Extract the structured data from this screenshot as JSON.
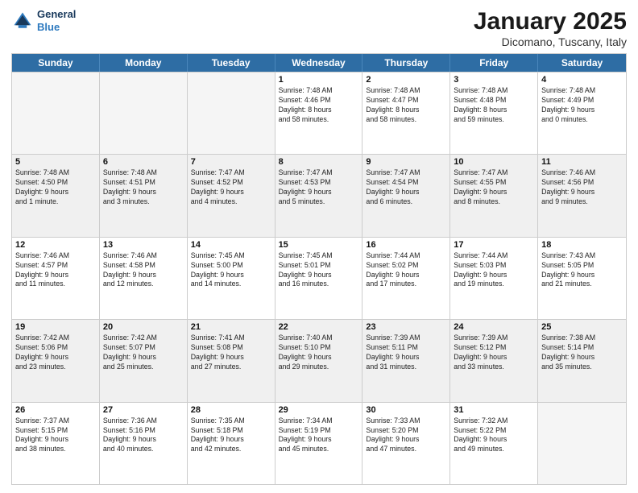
{
  "header": {
    "logo_general": "General",
    "logo_blue": "Blue",
    "month_title": "January 2025",
    "location": "Dicomano, Tuscany, Italy"
  },
  "days_of_week": [
    "Sunday",
    "Monday",
    "Tuesday",
    "Wednesday",
    "Thursday",
    "Friday",
    "Saturday"
  ],
  "rows": [
    [
      {
        "day": "",
        "text": "",
        "empty": true
      },
      {
        "day": "",
        "text": "",
        "empty": true
      },
      {
        "day": "",
        "text": "",
        "empty": true
      },
      {
        "day": "1",
        "text": "Sunrise: 7:48 AM\nSunset: 4:46 PM\nDaylight: 8 hours\nand 58 minutes."
      },
      {
        "day": "2",
        "text": "Sunrise: 7:48 AM\nSunset: 4:47 PM\nDaylight: 8 hours\nand 58 minutes."
      },
      {
        "day": "3",
        "text": "Sunrise: 7:48 AM\nSunset: 4:48 PM\nDaylight: 8 hours\nand 59 minutes."
      },
      {
        "day": "4",
        "text": "Sunrise: 7:48 AM\nSunset: 4:49 PM\nDaylight: 9 hours\nand 0 minutes."
      }
    ],
    [
      {
        "day": "5",
        "text": "Sunrise: 7:48 AM\nSunset: 4:50 PM\nDaylight: 9 hours\nand 1 minute."
      },
      {
        "day": "6",
        "text": "Sunrise: 7:48 AM\nSunset: 4:51 PM\nDaylight: 9 hours\nand 3 minutes."
      },
      {
        "day": "7",
        "text": "Sunrise: 7:47 AM\nSunset: 4:52 PM\nDaylight: 9 hours\nand 4 minutes."
      },
      {
        "day": "8",
        "text": "Sunrise: 7:47 AM\nSunset: 4:53 PM\nDaylight: 9 hours\nand 5 minutes."
      },
      {
        "day": "9",
        "text": "Sunrise: 7:47 AM\nSunset: 4:54 PM\nDaylight: 9 hours\nand 6 minutes."
      },
      {
        "day": "10",
        "text": "Sunrise: 7:47 AM\nSunset: 4:55 PM\nDaylight: 9 hours\nand 8 minutes."
      },
      {
        "day": "11",
        "text": "Sunrise: 7:46 AM\nSunset: 4:56 PM\nDaylight: 9 hours\nand 9 minutes."
      }
    ],
    [
      {
        "day": "12",
        "text": "Sunrise: 7:46 AM\nSunset: 4:57 PM\nDaylight: 9 hours\nand 11 minutes."
      },
      {
        "day": "13",
        "text": "Sunrise: 7:46 AM\nSunset: 4:58 PM\nDaylight: 9 hours\nand 12 minutes."
      },
      {
        "day": "14",
        "text": "Sunrise: 7:45 AM\nSunset: 5:00 PM\nDaylight: 9 hours\nand 14 minutes."
      },
      {
        "day": "15",
        "text": "Sunrise: 7:45 AM\nSunset: 5:01 PM\nDaylight: 9 hours\nand 16 minutes."
      },
      {
        "day": "16",
        "text": "Sunrise: 7:44 AM\nSunset: 5:02 PM\nDaylight: 9 hours\nand 17 minutes."
      },
      {
        "day": "17",
        "text": "Sunrise: 7:44 AM\nSunset: 5:03 PM\nDaylight: 9 hours\nand 19 minutes."
      },
      {
        "day": "18",
        "text": "Sunrise: 7:43 AM\nSunset: 5:05 PM\nDaylight: 9 hours\nand 21 minutes."
      }
    ],
    [
      {
        "day": "19",
        "text": "Sunrise: 7:42 AM\nSunset: 5:06 PM\nDaylight: 9 hours\nand 23 minutes."
      },
      {
        "day": "20",
        "text": "Sunrise: 7:42 AM\nSunset: 5:07 PM\nDaylight: 9 hours\nand 25 minutes."
      },
      {
        "day": "21",
        "text": "Sunrise: 7:41 AM\nSunset: 5:08 PM\nDaylight: 9 hours\nand 27 minutes."
      },
      {
        "day": "22",
        "text": "Sunrise: 7:40 AM\nSunset: 5:10 PM\nDaylight: 9 hours\nand 29 minutes."
      },
      {
        "day": "23",
        "text": "Sunrise: 7:39 AM\nSunset: 5:11 PM\nDaylight: 9 hours\nand 31 minutes."
      },
      {
        "day": "24",
        "text": "Sunrise: 7:39 AM\nSunset: 5:12 PM\nDaylight: 9 hours\nand 33 minutes."
      },
      {
        "day": "25",
        "text": "Sunrise: 7:38 AM\nSunset: 5:14 PM\nDaylight: 9 hours\nand 35 minutes."
      }
    ],
    [
      {
        "day": "26",
        "text": "Sunrise: 7:37 AM\nSunset: 5:15 PM\nDaylight: 9 hours\nand 38 minutes."
      },
      {
        "day": "27",
        "text": "Sunrise: 7:36 AM\nSunset: 5:16 PM\nDaylight: 9 hours\nand 40 minutes."
      },
      {
        "day": "28",
        "text": "Sunrise: 7:35 AM\nSunset: 5:18 PM\nDaylight: 9 hours\nand 42 minutes."
      },
      {
        "day": "29",
        "text": "Sunrise: 7:34 AM\nSunset: 5:19 PM\nDaylight: 9 hours\nand 45 minutes."
      },
      {
        "day": "30",
        "text": "Sunrise: 7:33 AM\nSunset: 5:20 PM\nDaylight: 9 hours\nand 47 minutes."
      },
      {
        "day": "31",
        "text": "Sunrise: 7:32 AM\nSunset: 5:22 PM\nDaylight: 9 hours\nand 49 minutes."
      },
      {
        "day": "",
        "text": "",
        "empty": true
      }
    ]
  ]
}
